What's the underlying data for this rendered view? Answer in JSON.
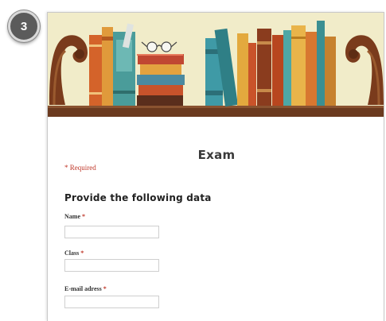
{
  "step": {
    "number": "3"
  },
  "form": {
    "title": "Exam",
    "required_note": "* Required",
    "section_title": "Provide the following data",
    "fields": [
      {
        "label": "Name",
        "required_mark": "*",
        "value": ""
      },
      {
        "label": "Class",
        "required_mark": "*",
        "value": ""
      },
      {
        "label": "E-mail adress",
        "required_mark": "*",
        "value": ""
      }
    ]
  },
  "colors": {
    "required_red": "#c0392b",
    "banner_background": "#efe9c4",
    "bookend_brown": "#7a3b1c",
    "shelf_brown": "#6b3a1f"
  },
  "icons": [
    "bookshelf-banner-illustration",
    "reading-glasses-icon"
  ]
}
